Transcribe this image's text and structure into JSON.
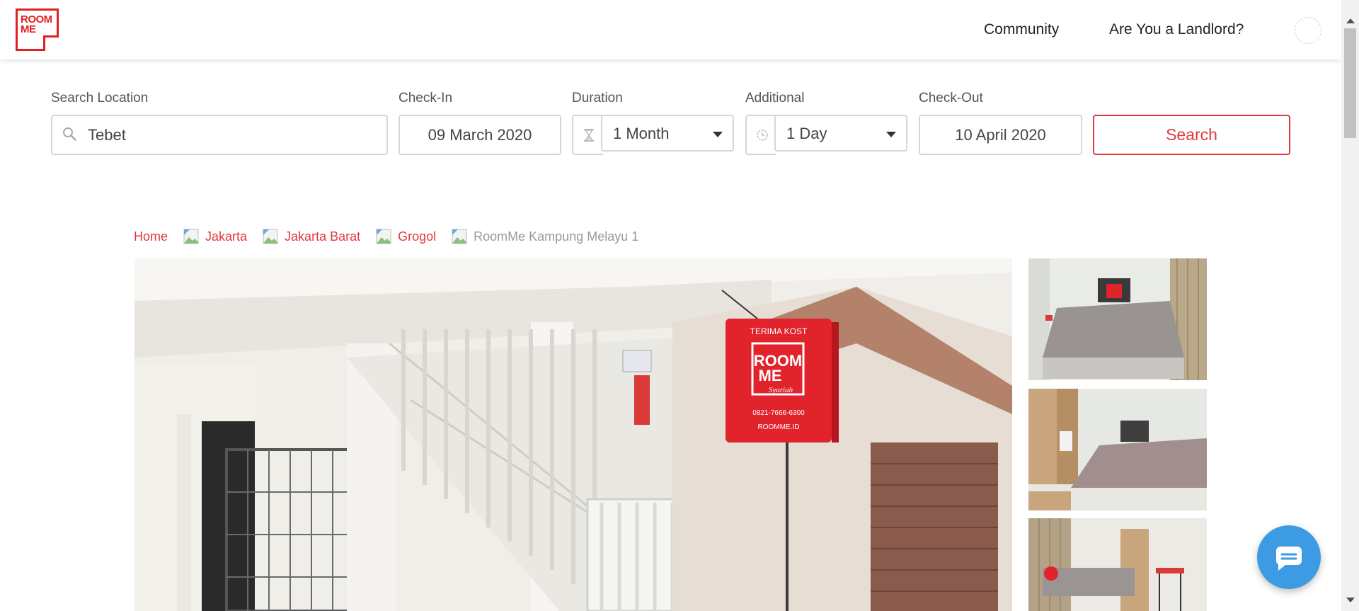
{
  "brand": {
    "logo_text": "ROOM\nME",
    "accent_color": "#e2383c"
  },
  "nav": {
    "community": "Community",
    "landlord": "Are You a Landlord?"
  },
  "search": {
    "location_label": "Search Location",
    "location_value": "Tebet",
    "checkin_label": "Check-In",
    "checkin_value": "09 March 2020",
    "duration_label": "Duration",
    "duration_value": "1 Month",
    "additional_label": "Additional",
    "additional_value": "1 Day",
    "checkout_label": "Check-Out",
    "checkout_value": "10 April 2020",
    "search_button": "Search"
  },
  "breadcrumb": {
    "home": "Home",
    "city": "Jakarta",
    "region": "Jakarta Barat",
    "district": "Grogol",
    "current": "RoomMe Kampung Melayu 1"
  },
  "photo_sign": {
    "top_text": "TERIMA KOST",
    "logo_line1": "ROOM",
    "logo_line2": "ME",
    "script": "Syariah",
    "phone": "0821-7666-6300",
    "site": "ROOMME.ID"
  },
  "icons": {
    "search": "search-icon",
    "duration": "hourglass-icon",
    "additional": "clock-icon",
    "chat": "chat-icon",
    "avatar": "user-avatar-icon"
  }
}
